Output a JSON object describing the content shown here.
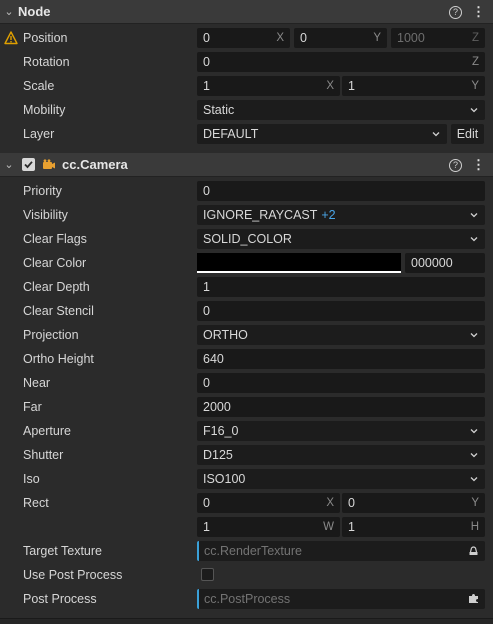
{
  "node": {
    "title": "Node",
    "position": {
      "label": "Position",
      "x": "0",
      "x_axis": "X",
      "y": "0",
      "y_axis": "Y",
      "z": "1000",
      "z_axis": "Z"
    },
    "rotation": {
      "label": "Rotation",
      "value": "0",
      "axis": "Z"
    },
    "scale": {
      "label": "Scale",
      "x": "1",
      "x_axis": "X",
      "y": "1",
      "y_axis": "Y"
    },
    "mobility": {
      "label": "Mobility",
      "value": "Static"
    },
    "layer": {
      "label": "Layer",
      "value": "DEFAULT",
      "edit_label": "Edit"
    }
  },
  "camera": {
    "title": "cc.Camera",
    "enabled": true,
    "priority": {
      "label": "Priority",
      "value": "0"
    },
    "visibility": {
      "label": "Visibility",
      "value": "IGNORE_RAYCAST",
      "extra": "+2"
    },
    "clear_flags": {
      "label": "Clear Flags",
      "value": "SOLID_COLOR"
    },
    "clear_color": {
      "label": "Clear Color",
      "hex": "000000",
      "color": "#000000"
    },
    "clear_depth": {
      "label": "Clear Depth",
      "value": "1"
    },
    "clear_stencil": {
      "label": "Clear Stencil",
      "value": "0"
    },
    "projection": {
      "label": "Projection",
      "value": "ORTHO"
    },
    "ortho_height": {
      "label": "Ortho Height",
      "value": "640"
    },
    "near": {
      "label": "Near",
      "value": "0"
    },
    "far": {
      "label": "Far",
      "value": "2000"
    },
    "aperture": {
      "label": "Aperture",
      "value": "F16_0"
    },
    "shutter": {
      "label": "Shutter",
      "value": "D125"
    },
    "iso": {
      "label": "Iso",
      "value": "ISO100"
    },
    "rect": {
      "label": "Rect",
      "x": "0",
      "x_axis": "X",
      "y": "0",
      "y_axis": "Y",
      "w": "1",
      "w_axis": "W",
      "h": "1",
      "h_axis": "H"
    },
    "target_texture": {
      "label": "Target Texture",
      "placeholder": "cc.RenderTexture"
    },
    "use_post_process": {
      "label": "Use Post Process",
      "checked": false
    },
    "post_process": {
      "label": "Post Process",
      "placeholder": "cc.PostProcess"
    }
  },
  "icons": {
    "warning": "warning-icon",
    "help": "help-icon",
    "more": "more-icon",
    "camera": "camera-icon",
    "caret": "chevron-down-icon",
    "texture": "texture-icon",
    "puzzle": "puzzle-icon"
  },
  "colors": {
    "accent": "#3aa0d8",
    "warning": "#e0a000",
    "link": "#4aa6e8",
    "camera_icon": "#e8a030"
  }
}
